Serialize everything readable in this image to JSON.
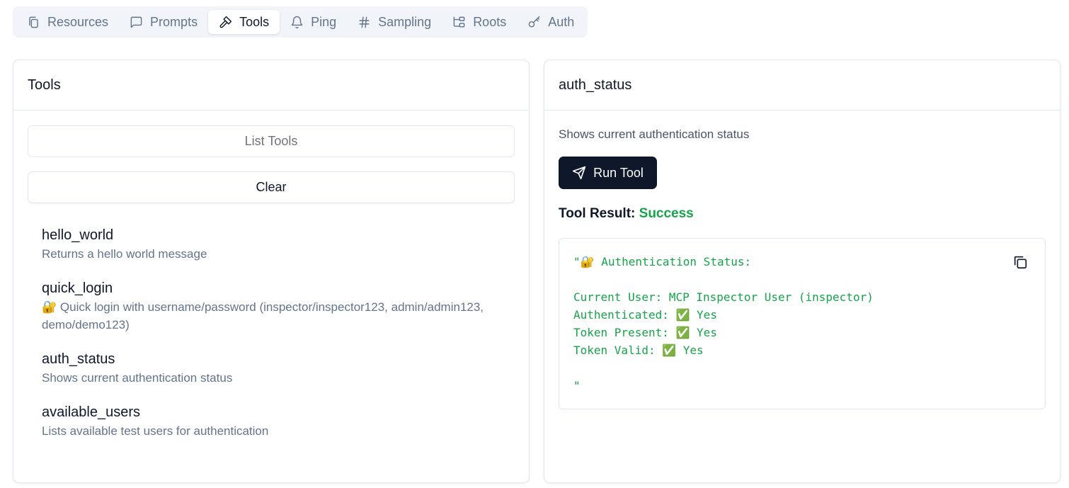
{
  "tabs": [
    {
      "label": "Resources",
      "icon": "files-icon"
    },
    {
      "label": "Prompts",
      "icon": "message-square-icon"
    },
    {
      "label": "Tools",
      "icon": "hammer-icon",
      "active": true
    },
    {
      "label": "Ping",
      "icon": "bell-icon"
    },
    {
      "label": "Sampling",
      "icon": "hash-icon"
    },
    {
      "label": "Roots",
      "icon": "folder-tree-icon"
    },
    {
      "label": "Auth",
      "icon": "key-icon"
    }
  ],
  "tools_panel": {
    "title": "Tools",
    "list_button": "List Tools",
    "clear_button": "Clear",
    "items": [
      {
        "name": "hello_world",
        "description": "Returns a hello world message"
      },
      {
        "name": "quick_login",
        "description": "🔐 Quick login with username/password (inspector/inspector123, admin/admin123, demo/demo123)"
      },
      {
        "name": "auth_status",
        "description": "Shows current authentication status"
      },
      {
        "name": "available_users",
        "description": "Lists available test users for authentication"
      }
    ]
  },
  "detail_panel": {
    "title": "auth_status",
    "description": "Shows current authentication status",
    "run_button": "Run Tool",
    "result_label": "Tool Result:",
    "result_status": "Success",
    "result_text": "\"🔐 Authentication Status:\n\nCurrent User: MCP Inspector User (inspector)\nAuthenticated: ✅ Yes\nToken Present: ✅ Yes\nToken Valid: ✅ Yes\n\n\""
  },
  "colors": {
    "accent_dark": "#0f172a",
    "success": "#16a34a",
    "muted": "#64748b",
    "border": "#e2e8f0",
    "tabbar_bg": "#f1f5f9"
  }
}
